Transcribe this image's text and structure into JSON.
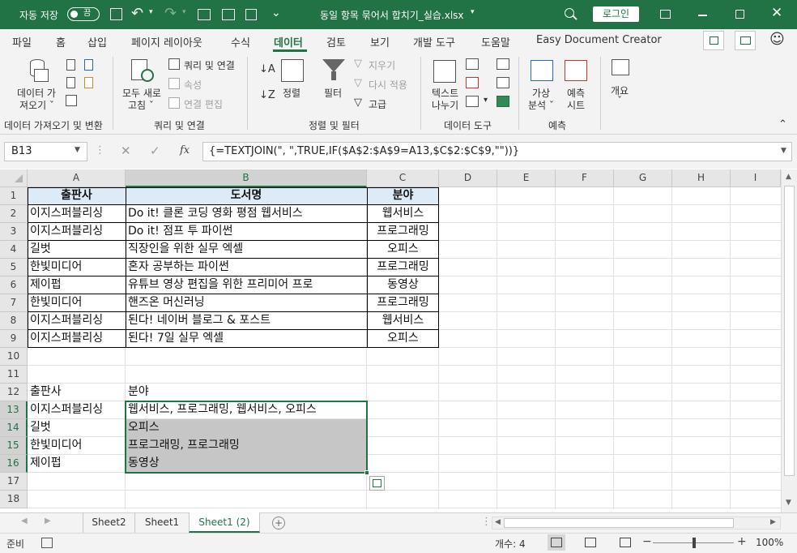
{
  "titlebar": {
    "autosave_label": "자동 저장",
    "autosave_state": "끔",
    "filename": "동일 항목 묶어서 합치기_실습.xlsx",
    "login_label": "로그인",
    "colors": {
      "accent": "#217346"
    }
  },
  "menu": {
    "tabs": [
      "파일",
      "홈",
      "삽입",
      "페이지 레이아웃",
      "수식",
      "데이터",
      "검토",
      "보기",
      "개발 도구",
      "도움말",
      "Easy Document Creator"
    ],
    "active_tab": "데이터"
  },
  "ribbon": {
    "get_data_line1": "데이터 가",
    "get_data_line2": "져오기 ˇ",
    "group_get": "데이터 가져오기 및 변환",
    "refresh_line1": "모두 새로",
    "refresh_line2": "고침 ˇ",
    "queries_connections": "쿼리 및 연결",
    "properties": "속성",
    "edit_links": "연결 편집",
    "group_queries": "쿼리 및 연결",
    "sort": "정렬",
    "filter": "필터",
    "clear": "지우기",
    "reapply": "다시 적용",
    "advanced": "고급",
    "group_sort": "정렬 및 필터",
    "text_to_columns_line1": "텍스트",
    "text_to_columns_line2": "나누기",
    "group_tools": "데이터 도구",
    "whatif_line1": "가상",
    "whatif_line2": "분석 ˇ",
    "forecast_line1": "예측",
    "forecast_line2": "시트",
    "group_forecast": "예측",
    "outline_line1": "개요",
    "outline_line2": "ˇ"
  },
  "formula_bar": {
    "name_box": "B13",
    "fx": "fx",
    "formula": "{=TEXTJOIN(\", \",TRUE,IF($A$2:$A$9=A13,$C$2:$C$9,\"\"))}"
  },
  "columns": [
    "A",
    "B",
    "C",
    "D",
    "E",
    "F",
    "G",
    "H",
    "I"
  ],
  "rows": [
    "1",
    "2",
    "3",
    "4",
    "5",
    "6",
    "7",
    "8",
    "9",
    "10",
    "11",
    "12",
    "13",
    "14",
    "15",
    "16",
    "17",
    "18"
  ],
  "table_header": {
    "a": "출판사",
    "b": "도서명",
    "c": "분야"
  },
  "table_rows": [
    {
      "a": "이지스퍼블리싱",
      "b": "Do it! 클론 코딩 영화 평점 웹서비스",
      "c": "웹서비스"
    },
    {
      "a": "이지스퍼블리싱",
      "b": "Do it! 점프 투 파이썬",
      "c": "프로그래밍"
    },
    {
      "a": "길벗",
      "b": "직장인을 위한 실무 엑셀",
      "c": "오피스"
    },
    {
      "a": "한빛미디어",
      "b": "혼자 공부하는 파이썬",
      "c": "프로그래밍"
    },
    {
      "a": "제이펍",
      "b": "유튜브 영상 편집을 위한 프리미어 프로",
      "c": "동영상"
    },
    {
      "a": "한빛미디어",
      "b": "핸즈온 머신러닝",
      "c": "프로그래밍"
    },
    {
      "a": "이지스퍼블리싱",
      "b": "된다! 네이버 블로그 & 포스트",
      "c": "웹서비스"
    },
    {
      "a": "이지스퍼블리싱",
      "b": "된다! 7일 실무 엑셀",
      "c": "오피스"
    }
  ],
  "result_header": {
    "a": "출판사",
    "b": "분야"
  },
  "result_rows": [
    {
      "a": "이지스퍼블리싱",
      "b": "웹서비스, 프로그래밍, 웹서비스, 오피스"
    },
    {
      "a": "길벗",
      "b": "오피스"
    },
    {
      "a": "한빛미디어",
      "b": "프로그래밍, 프로그래밍"
    },
    {
      "a": "제이펍",
      "b": "동영상"
    }
  ],
  "sheet_tabs": [
    "Sheet2",
    "Sheet1",
    "Sheet1 (2)"
  ],
  "active_sheet": "Sheet1 (2)",
  "status": {
    "ready": "준비",
    "count": "개수: 4",
    "zoom": "100%"
  }
}
